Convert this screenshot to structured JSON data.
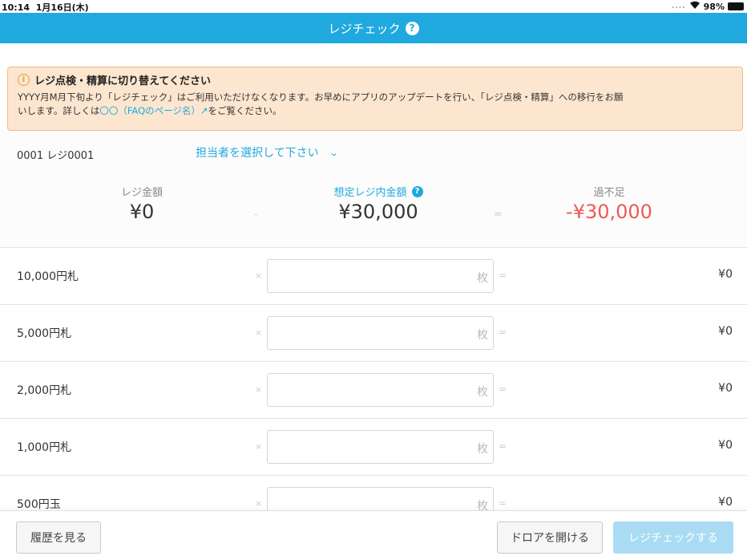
{
  "status_bar": {
    "time": "10:14",
    "date": "1月16日(木)",
    "signal_dots": "....",
    "battery": "98%"
  },
  "nav": {
    "title": "レジチェック",
    "help": "?"
  },
  "banner": {
    "title": "レジ点検・精算に切り替えてください",
    "body_1": "YYYY月M月下旬より「レジチェック」はご利用いただけなくなります。お早めにアプリのアップデートを行い、「レジ点検・精算」への移行をお願",
    "body_2_prefix": "いします。詳しくは",
    "body_2_link": "〇〇（FAQのページ名）",
    "body_2_link_icon": "↗",
    "body_2_suffix": "をご覧ください。",
    "icon": "info-icon"
  },
  "register": {
    "id": "0001 レジ0001",
    "staff_placeholder": "担当者を選択して下さい"
  },
  "summary": {
    "register_amount_label": "レジ金額",
    "register_amount": "¥0",
    "minus": "-",
    "expected_label": "想定レジ内金額",
    "expected_help": "?",
    "expected_amount": "¥30,000",
    "equals": "=",
    "diff_label": "過不足",
    "diff_amount": "-¥30,000"
  },
  "denominations": [
    {
      "name": "10,000円札",
      "times": "×",
      "unit": "枚",
      "eq": "=",
      "amount": "¥0"
    },
    {
      "name": "5,000円札",
      "times": "×",
      "unit": "枚",
      "eq": "=",
      "amount": "¥0"
    },
    {
      "name": "2,000円札",
      "times": "×",
      "unit": "枚",
      "eq": "=",
      "amount": "¥0"
    },
    {
      "name": "1,000円札",
      "times": "×",
      "unit": "枚",
      "eq": "=",
      "amount": "¥0"
    },
    {
      "name": "500円玉",
      "times": "×",
      "unit": "枚",
      "eq": "=",
      "amount": "¥0"
    }
  ],
  "footer": {
    "history": "履歴を見る",
    "open_drawer": "ドロアを開ける",
    "check": "レジチェックする"
  },
  "colors": {
    "brand": "#1fa9df",
    "negative": "#f05a55",
    "warning_bg": "#fde6cf"
  }
}
